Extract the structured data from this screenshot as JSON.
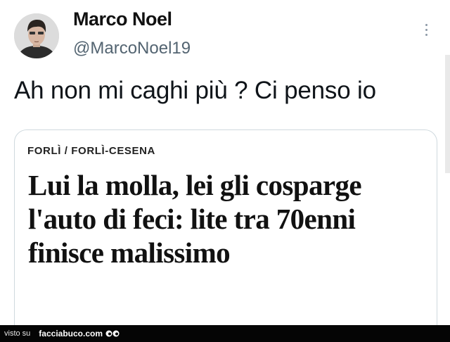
{
  "author": {
    "name": "Marco Noel",
    "handle": "@MarcoNoel19"
  },
  "tweet": {
    "text": "Ah non mi caghi più ? Ci penso io"
  },
  "card": {
    "kicker": "FORLÌ / FORLÌ-CESENA",
    "headline": "Lui la molla, lei gli cosparge l'auto di feci: lite tra 70enni finisce malissimo"
  },
  "icons": {
    "more": "more-vertical-icon",
    "eyes": "eyes-logo-icon"
  },
  "footer": {
    "visto_su": "visto su",
    "site": "facciabuco.com"
  },
  "colors": {
    "handle": "#536471",
    "card_border": "#cfd9de",
    "footer_bg": "#050505"
  }
}
